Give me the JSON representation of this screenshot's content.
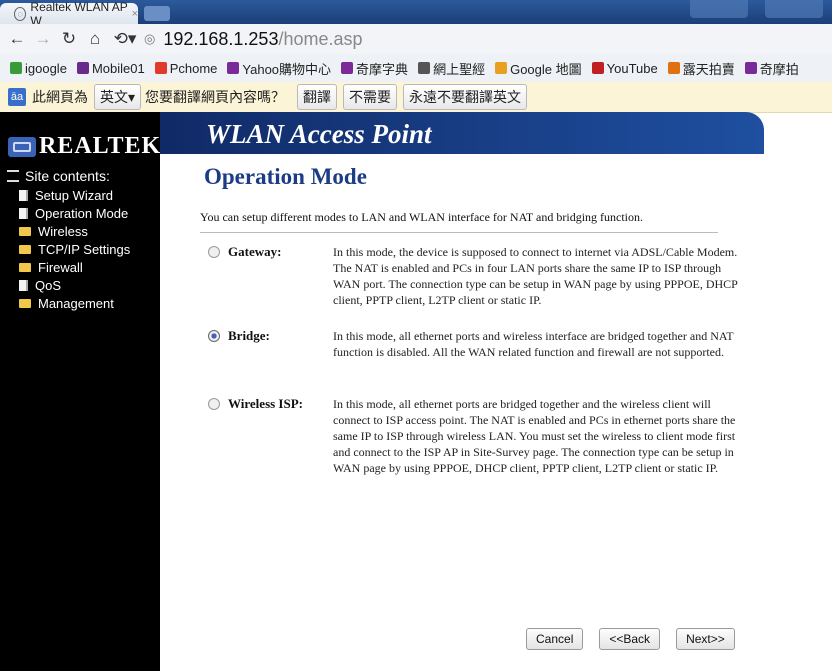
{
  "browser": {
    "tab_title": "Realtek WLAN AP W",
    "tab_close": "×",
    "address": {
      "host": "192.168.1.253",
      "path": "/home.asp"
    },
    "bookmarks": [
      {
        "label": "igoogle",
        "color": "#3a9b3a",
        "icon": "igoogle-icon"
      },
      {
        "label": "Mobile01",
        "color": "#6a2a8a",
        "icon": "mobile01-icon"
      },
      {
        "label": "Pchome",
        "color": "#e03a2a",
        "icon": "pchome-icon"
      },
      {
        "label": "Yahoo購物中心",
        "color": "#7b2a9a",
        "icon": "yahoo-icon"
      },
      {
        "label": "奇摩字典",
        "color": "#7b2a9a",
        "icon": "yahoo-dict-icon"
      },
      {
        "label": "網上聖經",
        "color": "#555555",
        "icon": "bible-icon"
      },
      {
        "label": "Google 地圖",
        "color": "#e8a020",
        "icon": "maps-icon"
      },
      {
        "label": "YouTube",
        "color": "#c02020",
        "icon": "youtube-icon"
      },
      {
        "label": "露天拍賣",
        "color": "#e07010",
        "icon": "ruten-icon"
      },
      {
        "label": "奇摩拍",
        "color": "#7b2a9a",
        "icon": "yahoo-auction-icon"
      }
    ],
    "translate_bar": {
      "logo": "āa",
      "prefix": "此網頁為",
      "language": "英文",
      "question": "您要翻譯網頁內容嗎？",
      "translate_button": "翻譯",
      "no_button": "不需要",
      "never_button": "永遠不要翻譯英文"
    }
  },
  "sidebar": {
    "logo_text": "REALTEK",
    "tree_root": "Site contents:",
    "items": [
      {
        "label": "Setup Wizard",
        "type": "page"
      },
      {
        "label": "Operation Mode",
        "type": "page"
      },
      {
        "label": "Wireless",
        "type": "folder"
      },
      {
        "label": "TCP/IP Settings",
        "type": "folder"
      },
      {
        "label": "Firewall",
        "type": "folder"
      },
      {
        "label": "QoS",
        "type": "page"
      },
      {
        "label": "Management",
        "type": "folder"
      }
    ]
  },
  "banner": {
    "title": "WLAN Access Point"
  },
  "main": {
    "title": "Operation Mode",
    "intro": "You can setup different modes to LAN and WLAN interface for NAT and bridging function.",
    "options": [
      {
        "label": "Gateway:",
        "checked": false,
        "description": "In this mode, the device is supposed to connect to internet via ADSL/Cable Modem. The NAT is enabled and PCs in four LAN ports share the same IP to ISP through WAN port. The connection type can be setup in WAN page by using PPPOE, DHCP client, PPTP client, L2TP client or static IP."
      },
      {
        "label": "Bridge:",
        "checked": true,
        "description": "In this mode, all ethernet ports and wireless interface are bridged together and NAT function is disabled. All the WAN related function and firewall are not supported."
      },
      {
        "label": "Wireless ISP:",
        "checked": false,
        "description": "In this mode, all ethernet ports are bridged together and the wireless client will connect to ISP access point. The NAT is enabled and PCs in ethernet ports share the same IP to ISP through wireless LAN. You must set the wireless to client mode first and connect to the ISP AP in Site-Survey page. The connection type can be setup in WAN page by using PPPOE, DHCP client, PPTP client, L2TP client or static IP."
      }
    ],
    "buttons": {
      "cancel": "Cancel",
      "back": "<<Back",
      "next": "Next>>"
    }
  }
}
